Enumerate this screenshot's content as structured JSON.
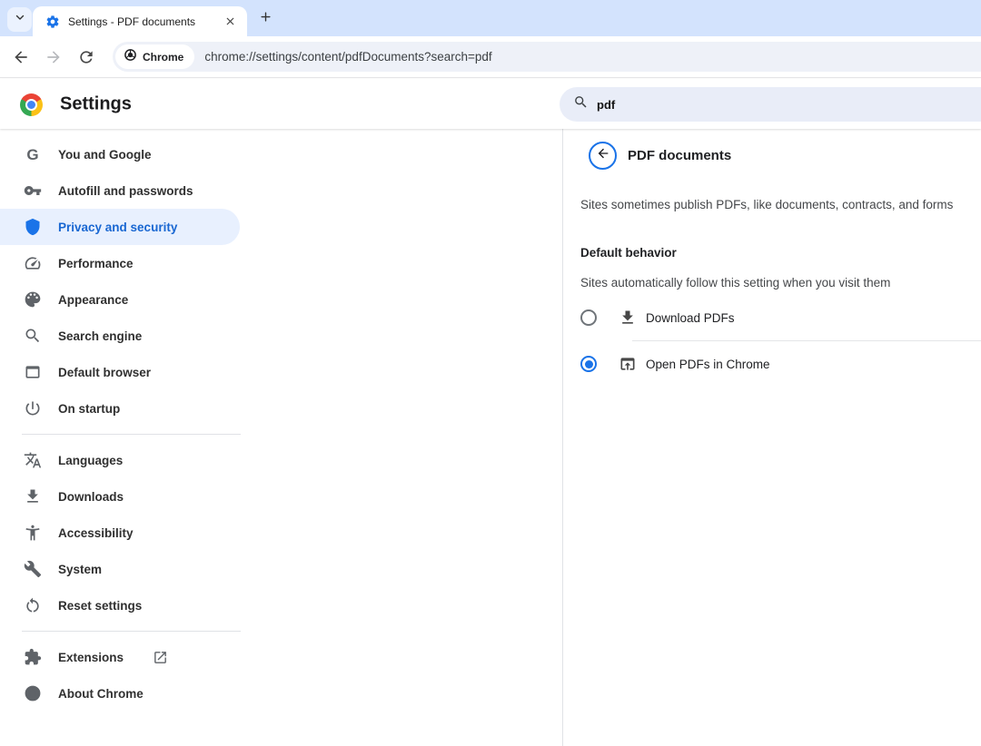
{
  "browser": {
    "tab_title": "Settings - PDF documents",
    "chip_label": "Chrome",
    "url": "chrome://settings/content/pdfDocuments?search=pdf"
  },
  "header": {
    "title": "Settings",
    "search_value": "pdf"
  },
  "sidebar": {
    "groups": [
      {
        "items": [
          {
            "label": "You and Google",
            "icon": "google-g",
            "selected": false
          },
          {
            "label": "Autofill and passwords",
            "icon": "key",
            "selected": false
          },
          {
            "label": "Privacy and security",
            "icon": "shield",
            "selected": true
          },
          {
            "label": "Performance",
            "icon": "speedometer",
            "selected": false
          },
          {
            "label": "Appearance",
            "icon": "palette",
            "selected": false
          },
          {
            "label": "Search engine",
            "icon": "magnifier",
            "selected": false
          },
          {
            "label": "Default browser",
            "icon": "browser-window",
            "selected": false
          },
          {
            "label": "On startup",
            "icon": "power",
            "selected": false
          }
        ]
      },
      {
        "items": [
          {
            "label": "Languages",
            "icon": "translate",
            "selected": false
          },
          {
            "label": "Downloads",
            "icon": "download",
            "selected": false
          },
          {
            "label": "Accessibility",
            "icon": "accessibility-person",
            "selected": false
          },
          {
            "label": "System",
            "icon": "wrench",
            "selected": false
          },
          {
            "label": "Reset settings",
            "icon": "reset-arrow",
            "selected": false
          }
        ]
      },
      {
        "items": [
          {
            "label": "Extensions",
            "icon": "puzzle-piece",
            "external": true,
            "selected": false
          },
          {
            "label": "About Chrome",
            "icon": "chrome-logo-mono",
            "selected": false
          }
        ]
      }
    ]
  },
  "content": {
    "page_title": "PDF documents",
    "intro": "Sites sometimes publish PDFs, like documents, contracts, and forms",
    "section_title": "Default behavior",
    "section_subtitle": "Sites automatically follow this setting when you visit them",
    "options": [
      {
        "label": "Download PDFs",
        "icon": "download",
        "selected": false
      },
      {
        "label": "Open PDFs in Chrome",
        "icon": "open-in-browser",
        "selected": true
      }
    ]
  },
  "colors": {
    "accent": "#1a73e8",
    "selected_text": "#1967d2",
    "selected_bg": "#e8f0fe",
    "tabstrip_bg": "#d3e3fd",
    "omnibox_bg": "#eef1f8",
    "search_pill_bg": "#e9edf8"
  }
}
